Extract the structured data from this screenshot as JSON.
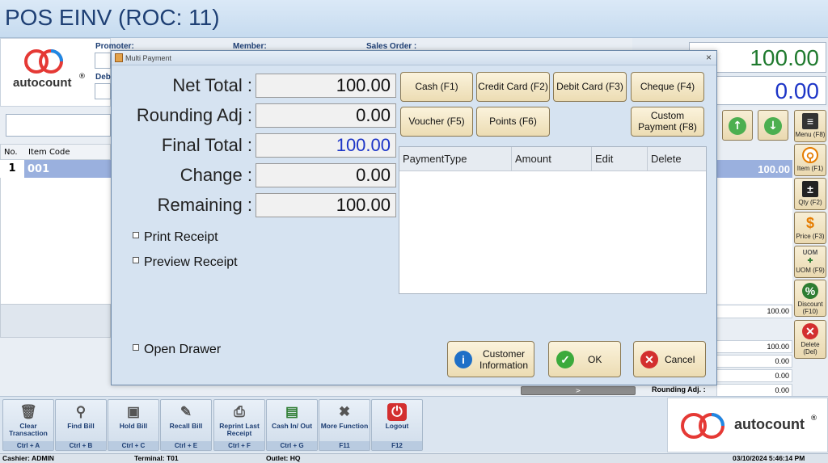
{
  "window": {
    "title": "POS EINV (ROC: 11)"
  },
  "header": {
    "promoter_label": "Promoter:",
    "member_label": "Member:",
    "sales_order_label": "Sales Order :",
    "debtor_label": "Deb",
    "total_top": "100.00",
    "total_second": "0.00"
  },
  "logo": {
    "text": "autocount",
    "reg": "®"
  },
  "background_table": {
    "col_no": "No.",
    "col_item_code": "Item Code",
    "row_no": "1",
    "row_item_code": "001",
    "row_amount": "100.00",
    "subtotal_small": "100.00"
  },
  "summary_small": {
    "values": [
      "100.00",
      "0.00",
      "0.00"
    ],
    "rounding_label": "Rounding Adj. :",
    "rounding_value": "0.00"
  },
  "side_toolbar": {
    "menu": "Menu (F8)",
    "item": "Item (F1)",
    "qty": "Qty (F2)",
    "price": "Price (F3)",
    "uom_tag": "UOM",
    "uom": "UOM (F9)",
    "discount": "Discount (F10)",
    "delete": "Delete (Del)"
  },
  "bottom_toolbar": [
    {
      "label": "Clear Transaction",
      "key": "Ctrl + A",
      "icon": "clear-icon"
    },
    {
      "label": "Find Bill",
      "key": "Ctrl + B",
      "icon": "find-icon"
    },
    {
      "label": "Hold Bill",
      "key": "Ctrl + C",
      "icon": "save-icon"
    },
    {
      "label": "Recall Bill",
      "key": "Ctrl + E",
      "icon": "recall-icon"
    },
    {
      "label": "Reprint Last Receipt",
      "key": "Ctrl + F",
      "icon": "printer-icon"
    },
    {
      "label": "Cash In/ Out",
      "key": "Ctrl + G",
      "icon": "cash-icon"
    },
    {
      "label": "More Function",
      "key": "F11",
      "icon": "tools-icon"
    },
    {
      "label": "Logout",
      "key": "F12",
      "icon": "power-icon"
    }
  ],
  "status_bar": {
    "cashier": "Cashier: ADMIN",
    "terminal": "Terminal: T01",
    "outlet": "Outlet: HQ",
    "datetime": "03/10/2024 5:46:14 PM"
  },
  "dialog": {
    "title": "Multi Payment",
    "close": "×",
    "summary": [
      {
        "label": "Net Total :",
        "value": "100.00"
      },
      {
        "label": "Rounding Adj :",
        "value": "0.00"
      },
      {
        "label": "Final Total :",
        "value": "100.00"
      },
      {
        "label": "Change :",
        "value": "0.00"
      },
      {
        "label": "Remaining :",
        "value": "100.00"
      }
    ],
    "checkboxes": {
      "print_receipt": "Print Receipt",
      "preview_receipt": "Preview Receipt",
      "open_drawer": "Open Drawer"
    },
    "payment_buttons": {
      "cash": "Cash (F1)",
      "credit_card": "Credit Card (F2)",
      "debit_card": "Debit Card (F3)",
      "cheque": "Cheque (F4)",
      "voucher": "Voucher (F5)",
      "points": "Points (F6)",
      "custom_payment": "Custom Payment (F8)"
    },
    "grid_columns": [
      "PaymentType",
      "Amount",
      "Edit",
      "Delete"
    ],
    "actions": {
      "customer_info": "Customer Information",
      "ok": "OK",
      "cancel": "Cancel"
    }
  },
  "scrollbar_arrow": ">",
  "colors": {
    "accent_blue": "#1e3f74",
    "final_total_blue": "#1d35c7",
    "total_green": "#1f7a2e",
    "button_tan": "#ecdcb3"
  }
}
